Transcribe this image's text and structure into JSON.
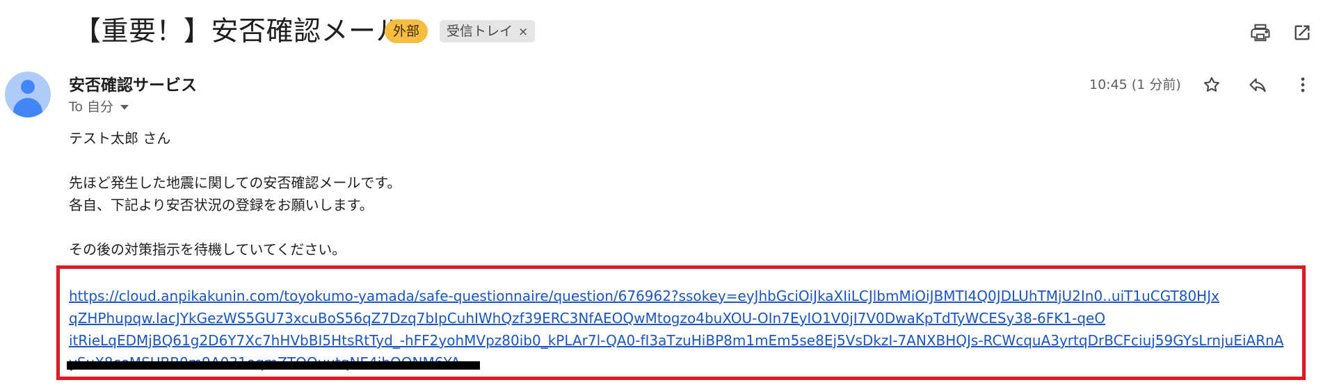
{
  "email": {
    "subject": "【重要！】安否確認メール",
    "labels": {
      "external": "外部",
      "inbox": "受信トレイ",
      "inbox_remove": "×"
    },
    "sender_name": "安否確認サービス",
    "recipient_line": "To 自分",
    "time": "10:45 (1 分前)",
    "greeting": "テスト太郎 さん",
    "body_line1": "先ほど発生した地震に関しての安否確認メールです。",
    "body_line2": "各自、下記より安否状況の登録をお願いします。",
    "body_line3": "その後の対策指示を待機していてください。",
    "link_line1": "https://cloud.anpikakunin.com/toyokumo-yamada/safe-questionnaire/question/676962?ssokey=eyJhbGciOiJkaXIiLCJlbmMiOiJBMTI4Q0JDLUhTMjU2In0..uiT1uCGT80HJx",
    "link_line2": "qZHPhupqw.lacJYkGezWS5GU73xcuBoS56qZ7Dzq7bIpCuhIWhQzf39ERC3NfAEOQwMtogzo4buXOU-OIn7EyIO1V0jI7V0DwaKpTdTyWCESy38-6FK1-qeO",
    "link_line3": "itRieLqEDMjBQ61g2D6Y7Xc7hHVbBI5HtsRtTyd_-hFF2yohMVpz80ib0_kPLAr7l-QA0-fI3aTzuHiBP8m1mEm5se8Ej5VsDkzI-7ANXBHQJs-RCWcquA3yrtqDrBCFciuj59GYsLrnjuEiARnA",
    "link_line4": "ySuX8ceMSUBB0m9A031oqmZTOOuutqNE4ibOONM6YA"
  },
  "icons": {
    "print": "print-icon",
    "open_new_window": "open-in-new-window-icon",
    "star": "star-icon",
    "reply": "reply-icon",
    "more": "more-vertical-icon",
    "avatar": "avatar-icon",
    "dropdown": "chevron-down-icon"
  },
  "colors": {
    "external_badge": "#f7bd43",
    "inbox_badge": "#e5e5e5",
    "link": "#1a55c4",
    "highlight_border": "#e01a22",
    "avatar_bg": "#aecbfa",
    "avatar_fg": "#4285f4"
  }
}
